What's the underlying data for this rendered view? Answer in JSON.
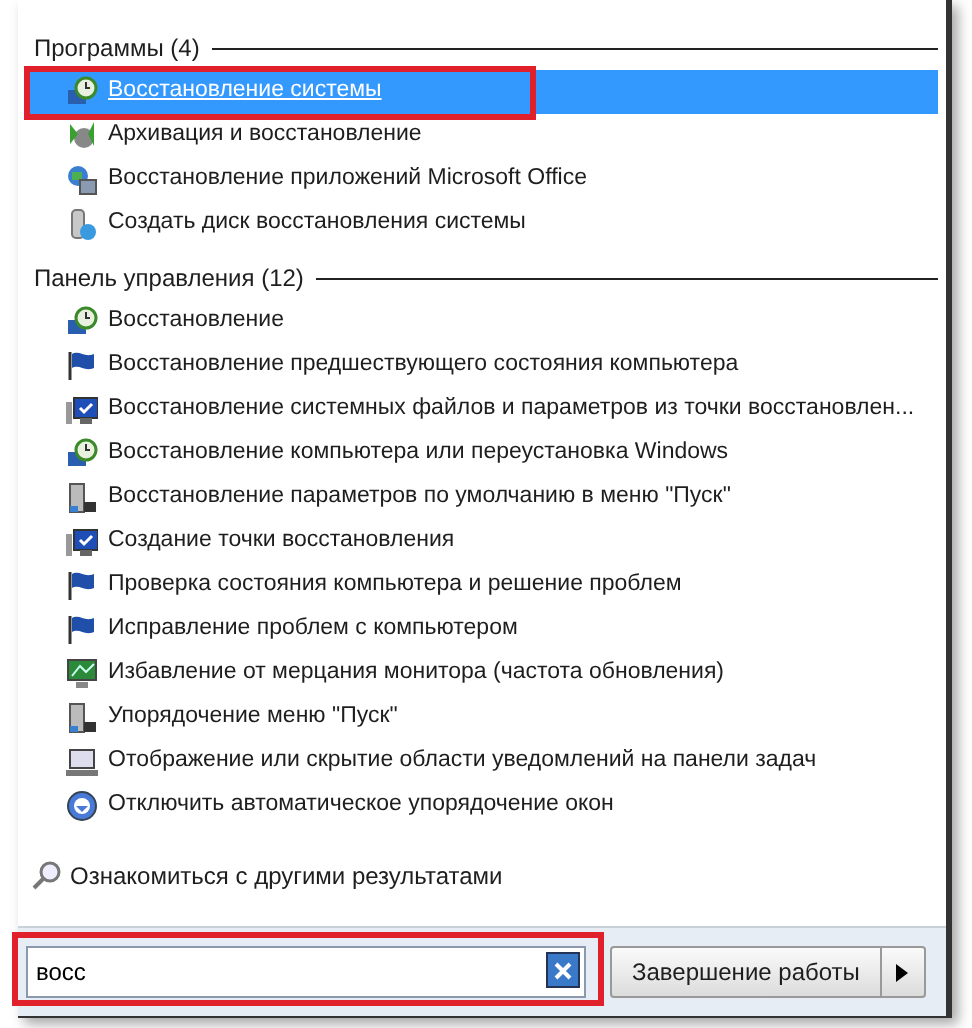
{
  "sections": [
    {
      "title": "Программы (4)",
      "items": [
        {
          "label": "Восстановление системы",
          "kind": "restore",
          "selected": true
        },
        {
          "label": "Архивация и восстановление",
          "kind": "backup",
          "selected": false
        },
        {
          "label": "Восстановление приложений Microsoft Office",
          "kind": "globe",
          "selected": false
        },
        {
          "label": "Создать диск восстановления системы",
          "kind": "disk",
          "selected": false
        }
      ]
    },
    {
      "title": "Панель управления (12)",
      "items": [
        {
          "label": "Восстановление",
          "kind": "restore",
          "selected": false
        },
        {
          "label": "Восстановление предшествующего состояния компьютера",
          "kind": "flag",
          "selected": false
        },
        {
          "label": "Восстановление системных файлов и параметров из точки восстановлен...",
          "kind": "monitor",
          "selected": false
        },
        {
          "label": "Восстановление компьютера или переустановка Windows",
          "kind": "restore",
          "selected": false
        },
        {
          "label": "Восстановление параметров по умолчанию в меню \"Пуск\"",
          "kind": "tower",
          "selected": false
        },
        {
          "label": "Создание точки восстановления",
          "kind": "monitor",
          "selected": false
        },
        {
          "label": "Проверка состояния компьютера и решение проблем",
          "kind": "flag",
          "selected": false
        },
        {
          "label": "Исправление проблем с компьютером",
          "kind": "flag",
          "selected": false
        },
        {
          "label": "Избавление от мерцания монитора (частота обновления)",
          "kind": "display",
          "selected": false
        },
        {
          "label": "Упорядочение меню \"Пуск\"",
          "kind": "tower",
          "selected": false
        },
        {
          "label": "Отображение или скрытие области уведомлений на панели задач",
          "kind": "laptop",
          "selected": false
        },
        {
          "label": "Отключить автоматическое упорядочение окон",
          "kind": "circle",
          "selected": false
        }
      ]
    }
  ],
  "more_results": "Ознакомиться с другими результатами",
  "search": {
    "value": "восс"
  },
  "shutdown": {
    "label": "Завершение работы"
  }
}
